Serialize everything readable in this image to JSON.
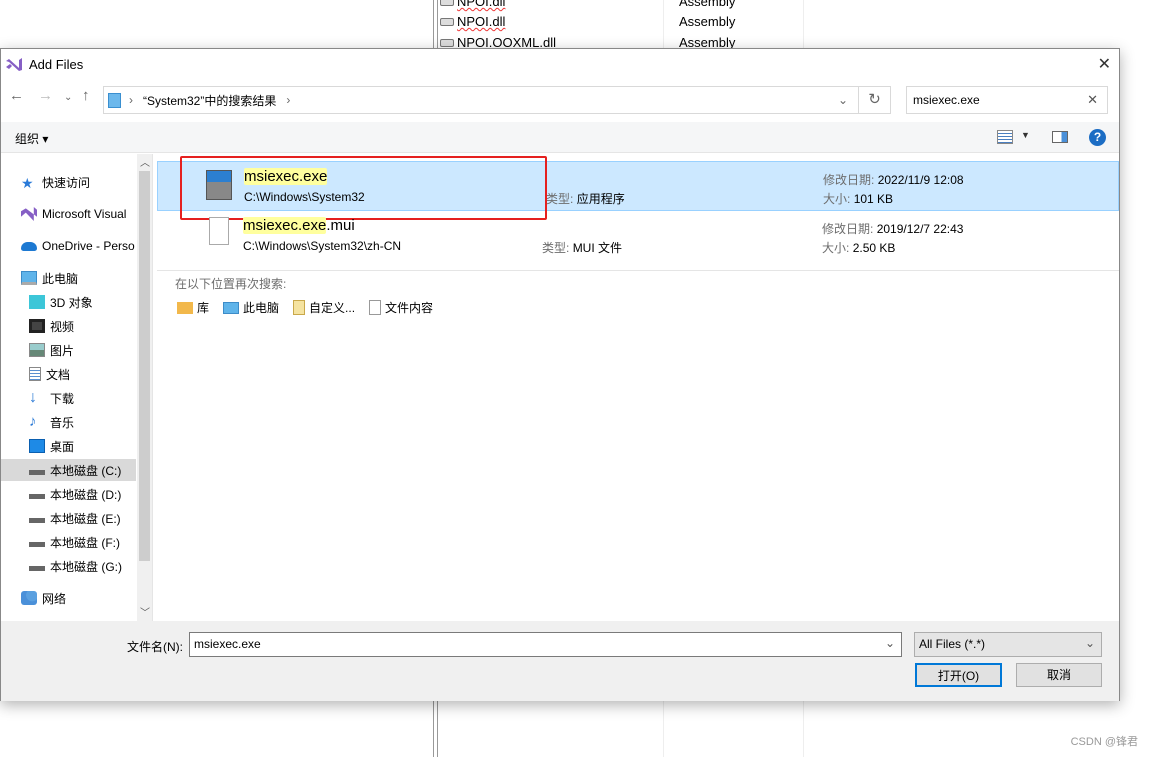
{
  "background": {
    "rows": [
      {
        "name": "NPOI.dll",
        "type": "Assembly"
      },
      {
        "name": "NPOI.dll",
        "type": "Assembly"
      },
      {
        "name": "NPOI.OOXML.dll",
        "type": "Assembly"
      }
    ]
  },
  "dialog": {
    "title": "Add Files",
    "close": "✕"
  },
  "address": {
    "path": "“System32”中的搜索结果",
    "search_value": "msiexec.exe"
  },
  "toolbar": {
    "organize": "组织 ▾",
    "help": "?"
  },
  "sidebar": {
    "items": [
      {
        "label": "快速访问",
        "icon": "star-icon"
      },
      {
        "label": "Microsoft Visual",
        "icon": "visual-studio-icon"
      },
      {
        "label": "OneDrive - Perso",
        "icon": "onedrive-icon"
      },
      {
        "label": "此电脑",
        "icon": "computer-icon"
      },
      {
        "label": "3D 对象",
        "icon": "3d-objects-icon"
      },
      {
        "label": "视频",
        "icon": "video-icon"
      },
      {
        "label": "图片",
        "icon": "picture-icon"
      },
      {
        "label": "文档",
        "icon": "document-icon"
      },
      {
        "label": "下载",
        "icon": "download-icon"
      },
      {
        "label": "音乐",
        "icon": "music-icon"
      },
      {
        "label": "桌面",
        "icon": "desktop-icon"
      },
      {
        "label": "本地磁盘 (C:)",
        "icon": "drive-icon",
        "selected": true
      },
      {
        "label": "本地磁盘 (D:)",
        "icon": "drive-icon"
      },
      {
        "label": "本地磁盘 (E:)",
        "icon": "drive-icon"
      },
      {
        "label": "本地磁盘 (F:)",
        "icon": "drive-icon"
      },
      {
        "label": "本地磁盘 (G:)",
        "icon": "drive-icon"
      },
      {
        "label": "网络",
        "icon": "network-icon"
      }
    ]
  },
  "files": [
    {
      "name_hl": "msiexec.exe",
      "name_rest": "",
      "path": "C:\\Windows\\System32",
      "type_label": "类型:",
      "type": "应用程序",
      "date_label": "修改日期:",
      "date": "2022/11/9 12:08",
      "size_label": "大小:",
      "size": "101 KB",
      "selected": true
    },
    {
      "name_hl": "msiexec.exe",
      "name_rest": ".mui",
      "path": "C:\\Windows\\System32\\zh-CN",
      "type_label": "类型:",
      "type": "MUI 文件",
      "date_label": "修改日期:",
      "date": "2019/12/7 22:43",
      "size_label": "大小:",
      "size": "2.50 KB"
    }
  ],
  "search_again": {
    "label": "在以下位置再次搜索:",
    "options": [
      "库",
      "此电脑",
      "自定义...",
      "文件内容"
    ]
  },
  "bottom": {
    "filename_label": "文件名(N):",
    "filename": "msiexec.exe",
    "filter": "All Files (*.*)",
    "open": "打开(O)",
    "cancel": "取消"
  },
  "watermark": "CSDN @锋君",
  "colors": {
    "selection": "#cce8ff",
    "highlight_box": "#e5201f",
    "search_hit": "#ffff9e"
  }
}
